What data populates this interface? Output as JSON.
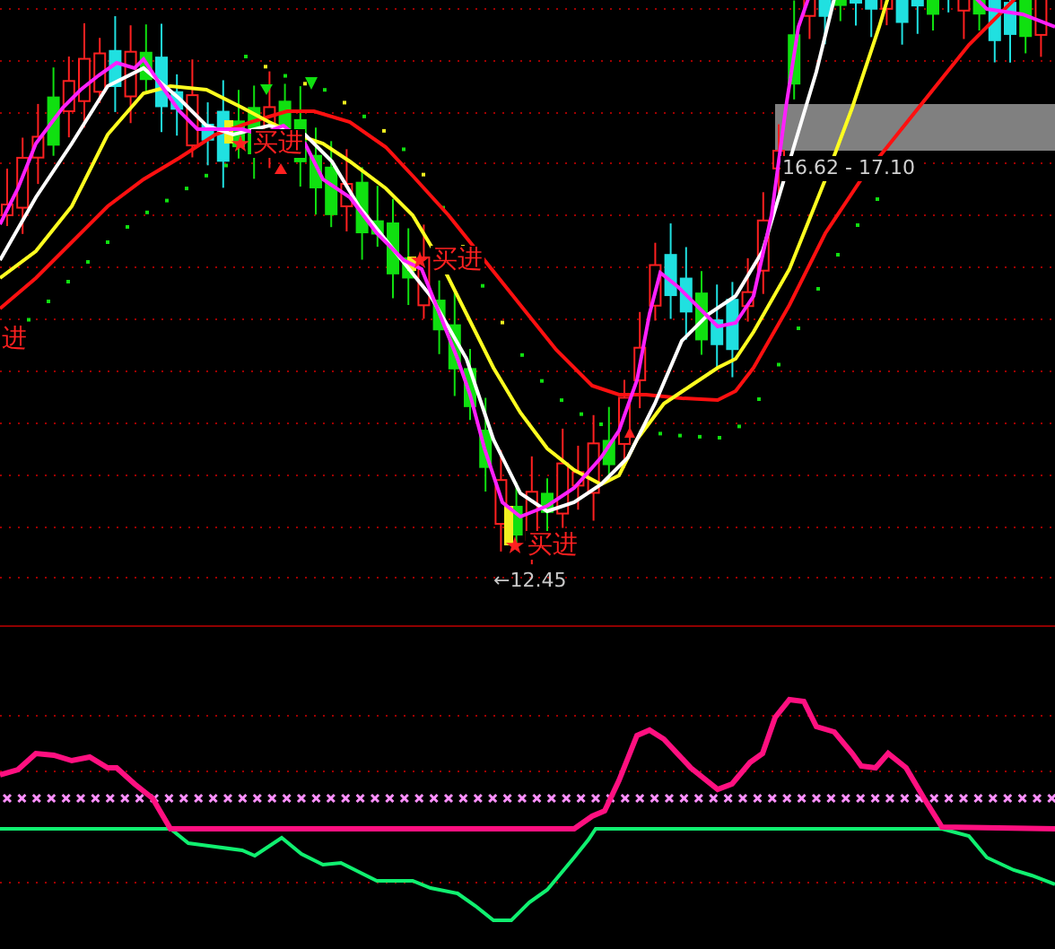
{
  "main_chart": {
    "annotations": [
      {
        "kind": "buy",
        "text": "进",
        "star": false
      },
      {
        "kind": "buy",
        "text": "买进",
        "star": true
      },
      {
        "kind": "buy",
        "text": "买进",
        "star": true
      },
      {
        "kind": "buy",
        "text": "买进",
        "star": true
      }
    ],
    "low_label": "←12.45",
    "range_label": "16.62 - 17.10"
  }
}
